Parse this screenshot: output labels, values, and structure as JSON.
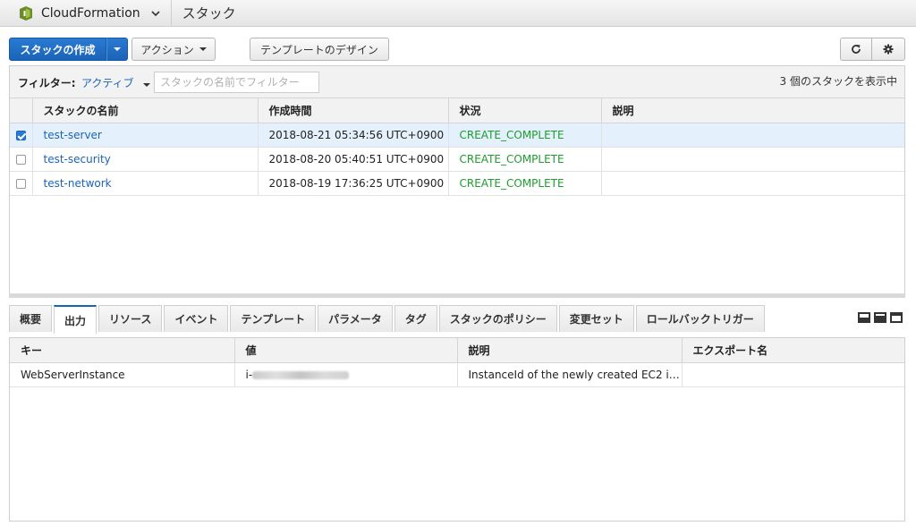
{
  "topbar": {
    "service_name": "CloudFormation",
    "breadcrumb": "スタック"
  },
  "toolbar": {
    "create_label": "スタックの作成",
    "action_label": "アクション",
    "design_label": "テンプレートのデザイン",
    "refresh_icon": "refresh-icon",
    "settings_icon": "gear-icon"
  },
  "filter": {
    "label": "フィルター:",
    "selected": "アクティブ",
    "placeholder": "スタックの名前でフィルター",
    "count_text": "3 個のスタックを表示中"
  },
  "stacks": {
    "columns": [
      "スタックの名前",
      "作成時間",
      "状況",
      "説明"
    ],
    "rows": [
      {
        "name": "test-server",
        "created": "2018-08-21 05:34:56 UTC+0900",
        "status": "CREATE_COMPLETE",
        "description": "",
        "selected": true
      },
      {
        "name": "test-security",
        "created": "2018-08-20 05:40:51 UTC+0900",
        "status": "CREATE_COMPLETE",
        "description": "",
        "selected": false
      },
      {
        "name": "test-network",
        "created": "2018-08-19 17:36:25 UTC+0900",
        "status": "CREATE_COMPLETE",
        "description": "",
        "selected": false
      }
    ]
  },
  "tabs": [
    {
      "label": "概要",
      "active": false
    },
    {
      "label": "出力",
      "active": true
    },
    {
      "label": "リソース",
      "active": false
    },
    {
      "label": "イベント",
      "active": false
    },
    {
      "label": "テンプレート",
      "active": false
    },
    {
      "label": "パラメータ",
      "active": false
    },
    {
      "label": "タグ",
      "active": false
    },
    {
      "label": "スタックのポリシー",
      "active": false
    },
    {
      "label": "変更セット",
      "active": false
    },
    {
      "label": "ロールバックトリガー",
      "active": false
    }
  ],
  "outputs": {
    "columns": [
      "キー",
      "値",
      "説明",
      "エクスポート名"
    ],
    "rows": [
      {
        "key": "WebServerInstance",
        "value_prefix": "i-",
        "description": "InstanceId of the newly created EC2 insta…",
        "export": ""
      }
    ]
  },
  "colors": {
    "primary": "#1a64b8",
    "status_ok": "#1d9e2c",
    "selected_row": "#e4f0fb"
  }
}
